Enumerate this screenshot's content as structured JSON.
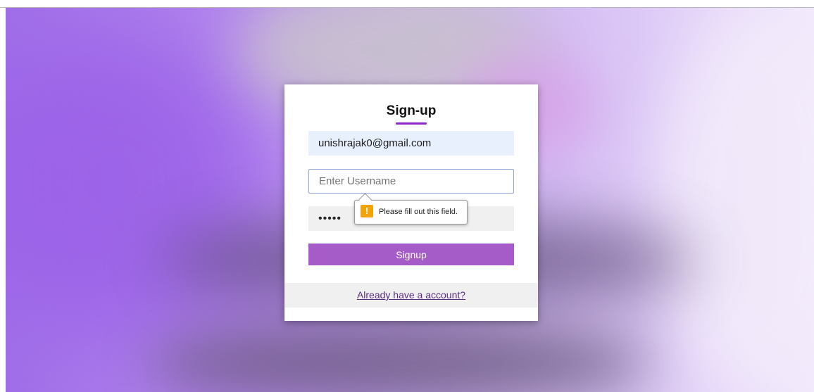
{
  "form": {
    "title": "Sign-up",
    "email_value": "unishrajak0@gmail.com",
    "username_placeholder": "Enter Username",
    "password_value": "•••••",
    "submit_label": "Signup",
    "login_link": "Already have a account?"
  },
  "validation": {
    "icon": "warning-icon",
    "icon_glyph": "!",
    "message": "Please fill out this field."
  },
  "colors": {
    "accent": "#8b25c7",
    "button": "#a55cc9",
    "link": "#5a2d82",
    "warning": "#f0a30a"
  }
}
